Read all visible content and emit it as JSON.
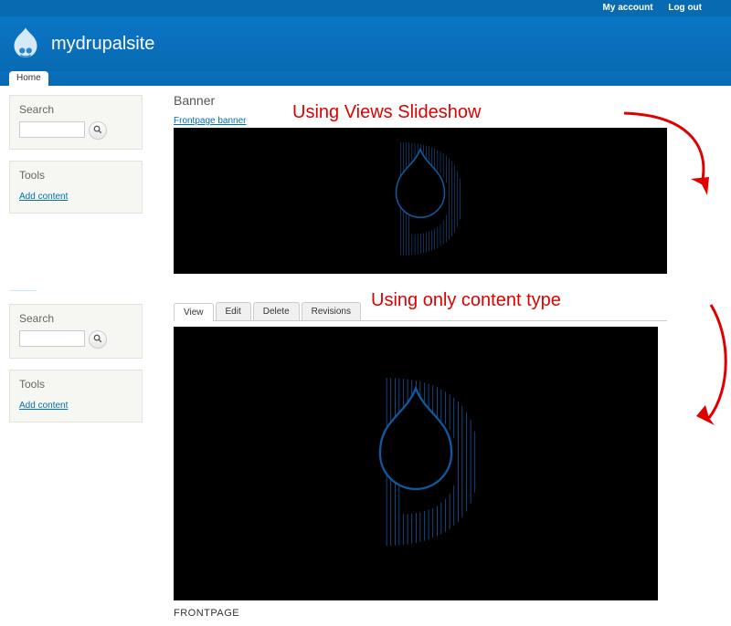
{
  "toplinks": {
    "account": "My account",
    "logout": "Log out"
  },
  "site": {
    "name": "mydrupalsite"
  },
  "nav": {
    "home": "Home"
  },
  "sidebar": {
    "search_label": "Search",
    "tools_label": "Tools",
    "add_content": "Add content"
  },
  "banner": {
    "heading": "Banner",
    "link": "Frontpage banner"
  },
  "tabs": {
    "view": "View",
    "edit": "Edit",
    "delete": "Delete",
    "revisions": "Revisions"
  },
  "footer": {
    "tag": "FRONTPAGE"
  },
  "annotations": {
    "a1": "Using Views Slideshow",
    "a2": "Using only content type"
  }
}
